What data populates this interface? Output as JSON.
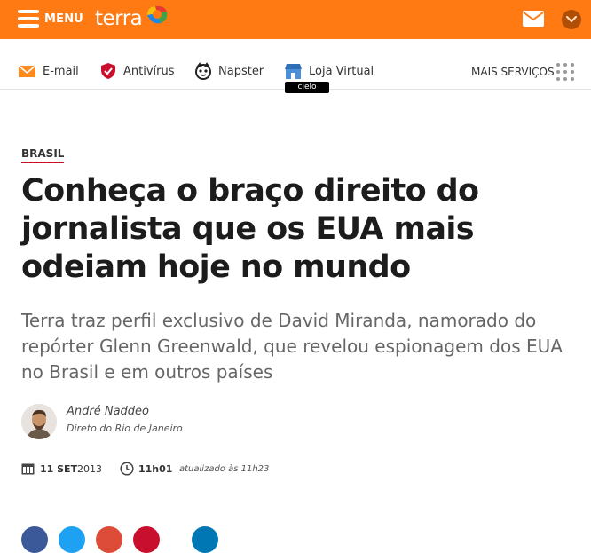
{
  "header": {
    "menu_label": "MENU",
    "brand": "terra",
    "colors": {
      "bar": "#ff7a12",
      "dropdown": "#b14e06"
    },
    "icons": [
      "hamburger-icon",
      "terra-logo",
      "mail-icon",
      "chevron-down-icon"
    ]
  },
  "services": {
    "items": [
      {
        "label": "E-mail",
        "icon": "envelope-icon"
      },
      {
        "label": "Antivírus",
        "icon": "shield-icon"
      },
      {
        "label": "Napster",
        "icon": "napster-icon"
      },
      {
        "label": "Loja Virtual",
        "icon": "store-icon"
      }
    ],
    "more_label": "MAIS SERVIÇOS",
    "badge": "cielo"
  },
  "article": {
    "section": "BRASIL",
    "title": "Conheça o braço direito do jornalista que os EUA mais odeiam hoje no mundo",
    "subtitle": "Terra traz perfil exclusivo de David Miranda, namorado do repórter Glenn Greenwald, que revelou espionagem dos EUA no Brasil e em outros países",
    "author": {
      "name": "André Naddeo",
      "role": "Direto do Rio de Janeiro"
    },
    "date": {
      "day": "11 SET",
      "year": "2013",
      "time": "11h01",
      "updated": "atualizado às 11h23"
    }
  },
  "share": {
    "colors": [
      "#3b5998",
      "#1da1f2",
      "#dd4b39",
      "#c8102e",
      "#0077b5"
    ]
  }
}
